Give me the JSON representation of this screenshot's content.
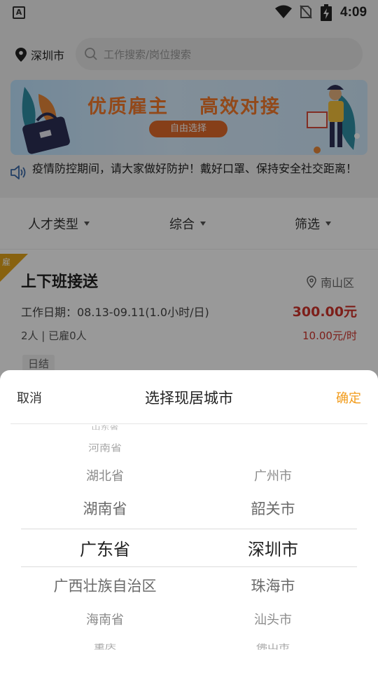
{
  "status_bar": {
    "time": "4:09",
    "app_badge": "A"
  },
  "header": {
    "city": "深圳市",
    "search_placeholder": "工作搜索/岗位搜索",
    "banner": {
      "title_left": "优质雇主",
      "title_right": "高效对接",
      "tag": "自由选择"
    },
    "notice": "疫情防控期间，请大家做好防护！戴好口罩、保持安全社交距离！"
  },
  "filters": [
    {
      "label": "人才类型"
    },
    {
      "label": "综合"
    },
    {
      "label": "筛选"
    }
  ],
  "job": {
    "corner_tag": "雇",
    "title": "上下班接送",
    "area": "南山区",
    "date": "工作日期：08.13-09.11(1.0小时/日)",
    "price": "300.00元",
    "people": "2人 | 已雇0人",
    "rate": "10.00元/时",
    "tag": "日结"
  },
  "picker": {
    "cancel_label": "取消",
    "title": "选择现居城市",
    "confirm_label": "确定",
    "provinces": [
      "山东省",
      "河南省",
      "湖北省",
      "湖南省",
      "广东省",
      "广西壮族自治区",
      "海南省",
      "重庆"
    ],
    "cities": [
      "广州市",
      "韶关市",
      "深圳市",
      "珠海市",
      "汕头市",
      "佛山市"
    ],
    "selected_province": "广东省",
    "selected_city": "深圳市"
  }
}
